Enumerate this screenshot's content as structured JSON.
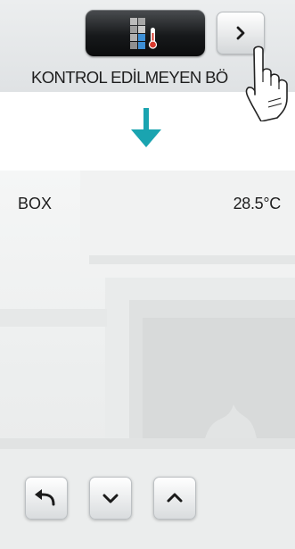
{
  "top_panel": {
    "zone_label": "KONTROL EDİLMEYEN BÖ",
    "zone_icon": "unmanaged-zone-thermometer-icon",
    "next_icon": "chevron-right-icon"
  },
  "transition_icon": "arrow-down-icon",
  "screen": {
    "box_label": "BOX",
    "temperature": "28.5°C",
    "buttons": [
      {
        "icon": "back-arrow-icon"
      },
      {
        "icon": "chevron-down-icon"
      },
      {
        "icon": "chevron-up-icon"
      }
    ]
  },
  "colors": {
    "accent": "#1aa4b0",
    "tile_dark": "#17191b",
    "zone_blue": "#3d8fd6",
    "thermo_red": "#d83a2e"
  }
}
